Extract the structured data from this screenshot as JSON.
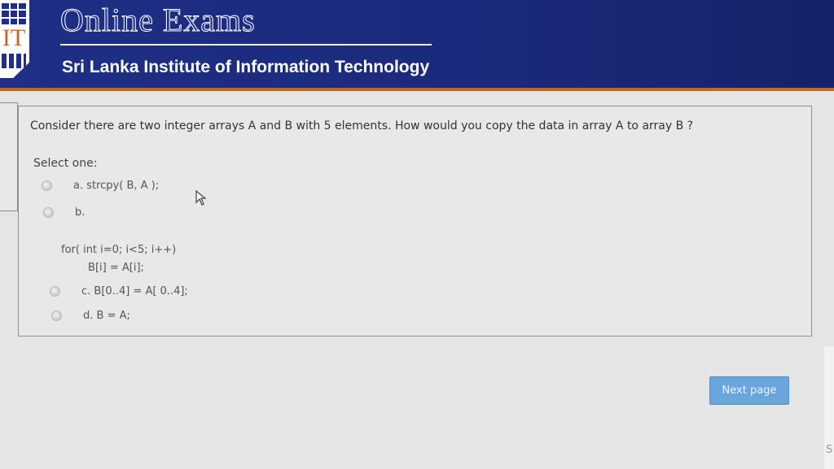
{
  "header": {
    "title": "Online Exams",
    "subtitle": "Sri Lanka Institute of Information Technology",
    "logo_text": "IT"
  },
  "question": {
    "text": "Consider there are two integer arrays A and B with 5 elements. How would you copy the data in array A to array B ?",
    "select_label": "Select one:",
    "options": [
      {
        "label": "a. strcpy( B, A );"
      },
      {
        "label": "b."
      },
      {
        "label": "c. B[0..4] = A[ 0..4];"
      },
      {
        "label": "d. B = A;"
      }
    ],
    "code_lines": [
      "for( int i=0; i<5; i++)",
      "        B[i] = A[i];"
    ]
  },
  "navigation": {
    "next_label": "Next page"
  },
  "edge": {
    "partial_text": "S"
  },
  "colors": {
    "header_bg": "#1f2f86",
    "header_accent": "#c9641f",
    "button_bg": "#6aa5dc"
  }
}
